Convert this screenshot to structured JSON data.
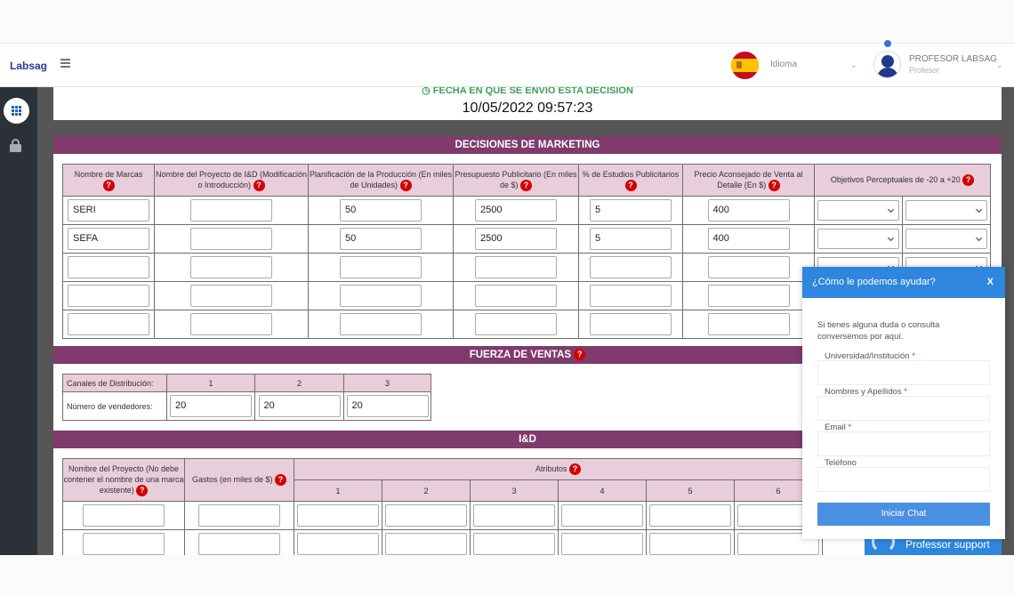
{
  "nav": {
    "brand": "Labsag",
    "language_label": "Idioma",
    "user_name": "PROFESOR LABSAG",
    "user_role": "Profesor"
  },
  "header": {
    "date_label": "FECHA EN QUE SE ENVIÓ ESTA DECISIÓN",
    "date_value": "10/05/2022 09:57:23"
  },
  "marketing": {
    "title": "DECISIONES DE MARKETING",
    "help_icon": "?",
    "columns": [
      "Nombre de Marcas",
      "Nombre del Proyecto de I&D (Modificación o Introducción)",
      "Planificación de la Producción (En miles de Unidades)",
      "Presupuesto Publicitario (En miles de $)",
      "% de Estudios Publicitarios",
      "Precio Aconsejado de Venta al Detalle (En $)",
      "Objetivos Perceptuales de -20 a +20"
    ],
    "rows": [
      {
        "brand": "SERI",
        "project": "",
        "production": "50",
        "budget": "2500",
        "studies": "5",
        "price": "400"
      },
      {
        "brand": "SEFA",
        "project": "",
        "production": "50",
        "budget": "2500",
        "studies": "5",
        "price": "400"
      },
      {
        "brand": "",
        "project": "",
        "production": "",
        "budget": "",
        "studies": "",
        "price": ""
      },
      {
        "brand": "",
        "project": "",
        "production": "",
        "budget": "",
        "studies": "",
        "price": ""
      },
      {
        "brand": "",
        "project": "",
        "production": "",
        "budget": "",
        "studies": "",
        "price": ""
      }
    ]
  },
  "sales": {
    "title": "FUERZA DE VENTAS",
    "channels_label": "Canales de Distribución:",
    "channels": [
      "1",
      "2",
      "3"
    ],
    "sellers_label": "Número de vendedores:",
    "sellers": [
      "20",
      "20",
      "20"
    ]
  },
  "rd": {
    "title": "I&D",
    "project_col": "Nombre del Proyecto (No debe contener el nombre de una marca existente)",
    "cost_col": "Gastos (en miles de $)",
    "attributes_label": "Atributos",
    "attributes": [
      "1",
      "2",
      "3",
      "4",
      "5",
      "6"
    ]
  },
  "chat": {
    "title": "¿Cómo le podemos ayudar?",
    "close": "X",
    "intro": "Si tienes alguna duda o consulta conversemos por aquí.",
    "fields": [
      {
        "label": "Universidad/Institución",
        "required": "*"
      },
      {
        "label": "Nombres y Apellidos",
        "required": "*"
      },
      {
        "label": "Email",
        "required": "*"
      },
      {
        "label": "Teléfono",
        "required": ""
      }
    ],
    "button": "Iniciar Chat",
    "support_label": "Professor support"
  },
  "colors": {
    "section_bar": "#7e3b6c",
    "header_cell": "#e8cdda",
    "chat_blue": "#2f86de",
    "help_red": "#d40000"
  }
}
